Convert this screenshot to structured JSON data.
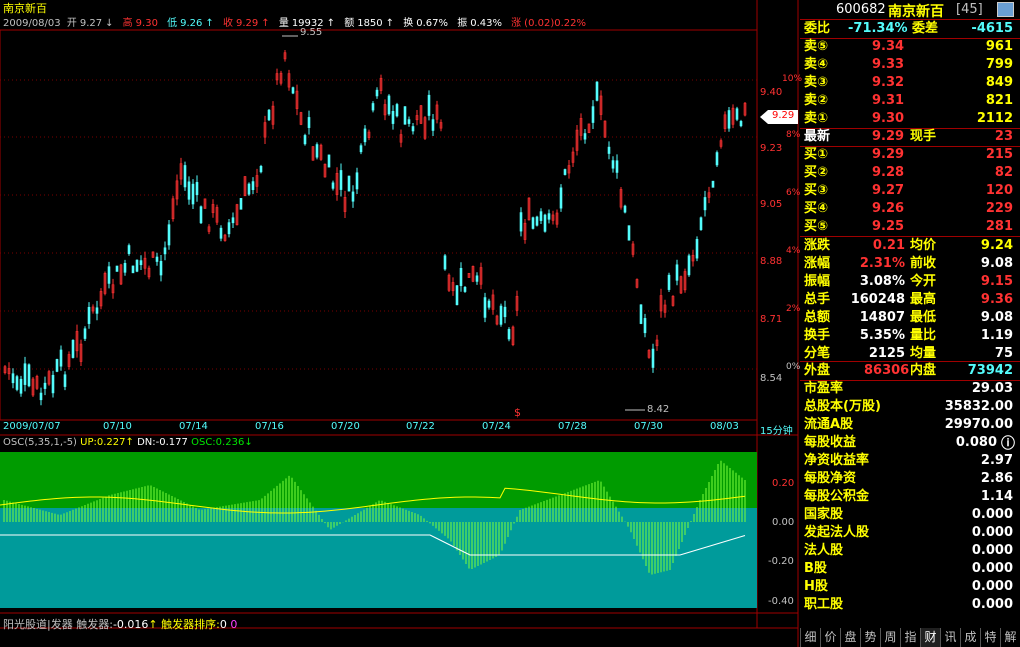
{
  "title": "南京新百",
  "info": {
    "date": "2009/08/03",
    "open_label": "开",
    "open": "9.27",
    "open_arrow": "↓",
    "high_label": "高",
    "high": "9.30",
    "low_label": "低",
    "low": "9.26",
    "low_arrow": "↑",
    "close_label": "收",
    "close": "9.29",
    "close_arrow": "↑",
    "vol_label": "量",
    "vol": "19932",
    "vol_arrow": "↑",
    "amt_label": "额",
    "amt": "1850",
    "amt_arrow": "↑",
    "turn_label": "换",
    "turn": "0.67%",
    "amp_label": "振",
    "amp": "0.43%",
    "chg_label": "涨",
    "chg": "(0.02)0.22%"
  },
  "price_axis": {
    "pct": [
      "10%",
      "8%",
      "6%",
      "4%",
      "2%",
      "0%"
    ],
    "price": [
      "9.40",
      "9.23",
      "9.05",
      "8.88",
      "8.71",
      "8.54"
    ],
    "current": "9.29"
  },
  "annotations": {
    "high": "9.55",
    "low": "8.42",
    "marker": "$"
  },
  "x_labels": [
    "2009/07/07",
    "07/10",
    "07/14",
    "07/16",
    "07/20",
    "07/22",
    "07/24",
    "07/28",
    "07/30",
    "08/03"
  ],
  "period": "15分钟",
  "osc": {
    "name": "OSC(5,35,1,-5)",
    "up_label": "UP:",
    "up": "0.227",
    "up_arrow": "↑",
    "dn_label": "DN:",
    "dn": "-0.177",
    "osc_label": "OSC:",
    "osc": "0.236",
    "osc_arrow": "↓",
    "axis": [
      "0.20",
      "0.00",
      "-0.20",
      "-0.40"
    ]
  },
  "bottom": {
    "text1": "阳光股道|发器",
    "label2": "触发器:",
    "val2": "-0.016",
    "arrow2": "↑",
    "label3": "触发器排序:",
    "val3": "0",
    "val4": "0"
  },
  "panel": {
    "code": "600682",
    "name": "南京新百",
    "count": "[45]",
    "weibi_label": "委比",
    "weibi": "-71.34%",
    "weicha_label": "委差",
    "weicha": "-4615",
    "sells": [
      {
        "label": "卖⑤",
        "price": "9.34",
        "vol": "961"
      },
      {
        "label": "卖④",
        "price": "9.33",
        "vol": "799"
      },
      {
        "label": "卖③",
        "price": "9.32",
        "vol": "849"
      },
      {
        "label": "卖②",
        "price": "9.31",
        "vol": "821"
      },
      {
        "label": "卖①",
        "price": "9.30",
        "vol": "2112"
      }
    ],
    "last_label": "最新",
    "last": "9.29",
    "xianshou_label": "现手",
    "xianshou": "23",
    "buys": [
      {
        "label": "买①",
        "price": "9.29",
        "vol": "215"
      },
      {
        "label": "买②",
        "price": "9.28",
        "vol": "82"
      },
      {
        "label": "买③",
        "price": "9.27",
        "vol": "120"
      },
      {
        "label": "买④",
        "price": "9.26",
        "vol": "229"
      },
      {
        "label": "买⑤",
        "price": "9.25",
        "vol": "281"
      }
    ],
    "stats": [
      {
        "l1": "涨跌",
        "v1": "0.21",
        "l2": "均价",
        "v2": "9.24"
      },
      {
        "l1": "涨幅",
        "v1": "2.31%",
        "l2": "前收",
        "v2": "9.08"
      },
      {
        "l1": "振幅",
        "v1": "3.08%",
        "l2": "今开",
        "v2": "9.15"
      },
      {
        "l1": "总手",
        "v1": "160248",
        "l2": "最高",
        "v2": "9.36"
      },
      {
        "l1": "总额",
        "v1": "14807",
        "l2": "最低",
        "v2": "9.08"
      },
      {
        "l1": "换手",
        "v1": "5.35%",
        "l2": "量比",
        "v2": "1.19"
      },
      {
        "l1": "分笔",
        "v1": "2125",
        "l2": "均量",
        "v2": "75"
      }
    ],
    "waipan_label": "外盘",
    "waipan": "86306",
    "neipan_label": "内盘",
    "neipan": "73942",
    "fin": [
      {
        "l": "市盈率",
        "v": "29.03"
      },
      {
        "l": "总股本(万股)",
        "v": "35832.00"
      },
      {
        "l": "流通A股",
        "v": "29970.00"
      },
      {
        "l": "每股收益",
        "v": "0.080"
      },
      {
        "l": "净资收益率",
        "v": "2.97"
      },
      {
        "l": "每股净资",
        "v": "2.86"
      },
      {
        "l": "每股公积金",
        "v": "1.14"
      },
      {
        "l": "国家股",
        "v": "0.000"
      },
      {
        "l": "发起法人股",
        "v": "0.000"
      },
      {
        "l": "法人股",
        "v": "0.000"
      },
      {
        "l": "B股",
        "v": "0.000"
      },
      {
        "l": "H股",
        "v": "0.000"
      },
      {
        "l": "职工股",
        "v": "0.000"
      }
    ],
    "info_icon": "info-circle-icon"
  },
  "tabs": [
    "细",
    "价",
    "盘",
    "势",
    "周",
    "指",
    "财",
    "讯",
    "成",
    "特",
    "解"
  ],
  "active_tab": "财",
  "colors": {
    "up": "#ff3232",
    "down": "#54fcfc",
    "label": "#ffff00",
    "osc_top": "#009b00",
    "osc_bottom": "#009b9b",
    "osc_bar": "#7dff3a"
  }
}
